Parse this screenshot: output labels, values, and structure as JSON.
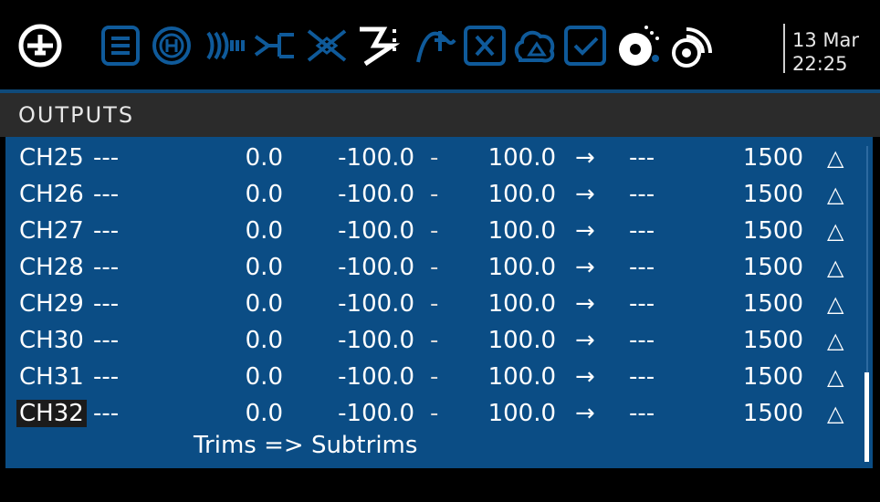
{
  "topbar": {
    "icons": [
      "model-select-icon",
      "model-setup-icon",
      "heli-icon",
      "inputs-icon",
      "mixes-icon",
      "outputs-icon",
      "curves-icon",
      "global-variables-icon",
      "logical-switches-icon",
      "special-functions-icon",
      "checklist-icon",
      "telemetry-icon",
      "sensors-icon"
    ],
    "active_icon": "outputs-icon",
    "date": "13 Mar",
    "time": "22:25"
  },
  "page": {
    "title": "OUTPUTS"
  },
  "channels": [
    {
      "name": "CH25",
      "label": "---",
      "offset": "0.0",
      "min": "-100.0",
      "sep": "-",
      "max": "100.0",
      "arrow": "→",
      "curve": "---",
      "ppm": "1500",
      "dir": "△"
    },
    {
      "name": "CH26",
      "label": "---",
      "offset": "0.0",
      "min": "-100.0",
      "sep": "-",
      "max": "100.0",
      "arrow": "→",
      "curve": "---",
      "ppm": "1500",
      "dir": "△"
    },
    {
      "name": "CH27",
      "label": "---",
      "offset": "0.0",
      "min": "-100.0",
      "sep": "-",
      "max": "100.0",
      "arrow": "→",
      "curve": "---",
      "ppm": "1500",
      "dir": "△"
    },
    {
      "name": "CH28",
      "label": "---",
      "offset": "0.0",
      "min": "-100.0",
      "sep": "-",
      "max": "100.0",
      "arrow": "→",
      "curve": "---",
      "ppm": "1500",
      "dir": "△"
    },
    {
      "name": "CH29",
      "label": "---",
      "offset": "0.0",
      "min": "-100.0",
      "sep": "-",
      "max": "100.0",
      "arrow": "→",
      "curve": "---",
      "ppm": "1500",
      "dir": "△"
    },
    {
      "name": "CH30",
      "label": "---",
      "offset": "0.0",
      "min": "-100.0",
      "sep": "-",
      "max": "100.0",
      "arrow": "→",
      "curve": "---",
      "ppm": "1500",
      "dir": "△"
    },
    {
      "name": "CH31",
      "label": "---",
      "offset": "0.0",
      "min": "-100.0",
      "sep": "-",
      "max": "100.0",
      "arrow": "→",
      "curve": "---",
      "ppm": "1500",
      "dir": "△"
    },
    {
      "name": "CH32",
      "label": "---",
      "offset": "0.0",
      "min": "-100.0",
      "sep": "-",
      "max": "100.0",
      "arrow": "→",
      "curve": "---",
      "ppm": "1500",
      "dir": "△"
    }
  ],
  "selected_channel": "CH32",
  "footer": {
    "action": "Trims => Subtrims"
  },
  "scroll": {
    "position_fraction": 0.72
  },
  "colors": {
    "list_bg": "#0b4d85",
    "icon_inactive": "#0f5a9a",
    "icon_active": "#ffffff",
    "title_bg": "#2b2b2b",
    "selection_bg": "#1b1b1b"
  }
}
